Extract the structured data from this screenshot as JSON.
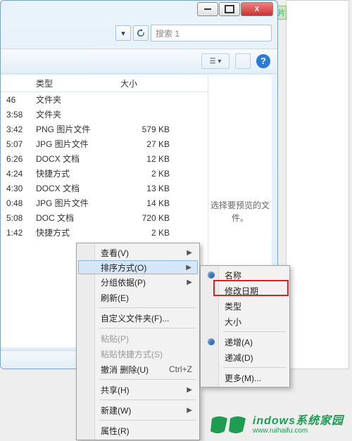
{
  "window_controls": {
    "min": "–",
    "max": "□",
    "close": "X"
  },
  "search": {
    "placeholder": "搜索 1"
  },
  "toolbar": {
    "view_dd": "☰ ▾",
    "help": "?"
  },
  "columns": {
    "type": "类型",
    "size": "大小"
  },
  "rows": [
    {
      "time": "46",
      "type": "文件夹",
      "size": ""
    },
    {
      "time": "3:58",
      "type": "文件夹",
      "size": ""
    },
    {
      "time": "3:42",
      "type": "PNG 图片文件",
      "size": "579 KB"
    },
    {
      "time": "5:07",
      "type": "JPG 图片文件",
      "size": "27 KB"
    },
    {
      "time": "6:26",
      "type": "DOCX 文档",
      "size": "12 KB"
    },
    {
      "time": "4:24",
      "type": "快捷方式",
      "size": "2 KB"
    },
    {
      "time": "4:30",
      "type": "DOCX 文档",
      "size": "13 KB"
    },
    {
      "time": "0:48",
      "type": "JPG 图片文件",
      "size": "14 KB"
    },
    {
      "time": "5:08",
      "type": "DOC 文档",
      "size": "720 KB"
    },
    {
      "time": "1:42",
      "type": "快捷方式",
      "size": "2 KB"
    }
  ],
  "preview_text": "选择要预览的文件。",
  "right_tab": "片",
  "ctx1": {
    "view": "查看(V)",
    "sort": "排序方式(O)",
    "group": "分组依据(P)",
    "refresh": "刷新(E)",
    "customize": "自定义文件夹(F)...",
    "paste": "粘贴(P)",
    "paste_shortcut": "粘贴快捷方式(S)",
    "undo": "撤消 删除(U)",
    "undo_hot": "Ctrl+Z",
    "share": "共享(H)",
    "new": "新建(W)",
    "properties": "属性(R)"
  },
  "ctx2": {
    "name": "名称",
    "date": "修改日期",
    "type": "类型",
    "size": "大小",
    "asc": "递增(A)",
    "desc": "递减(D)",
    "more": "更多(M)..."
  },
  "watermark": {
    "cn": "indows系统家园",
    "py": "www.ruihaifu.com"
  }
}
